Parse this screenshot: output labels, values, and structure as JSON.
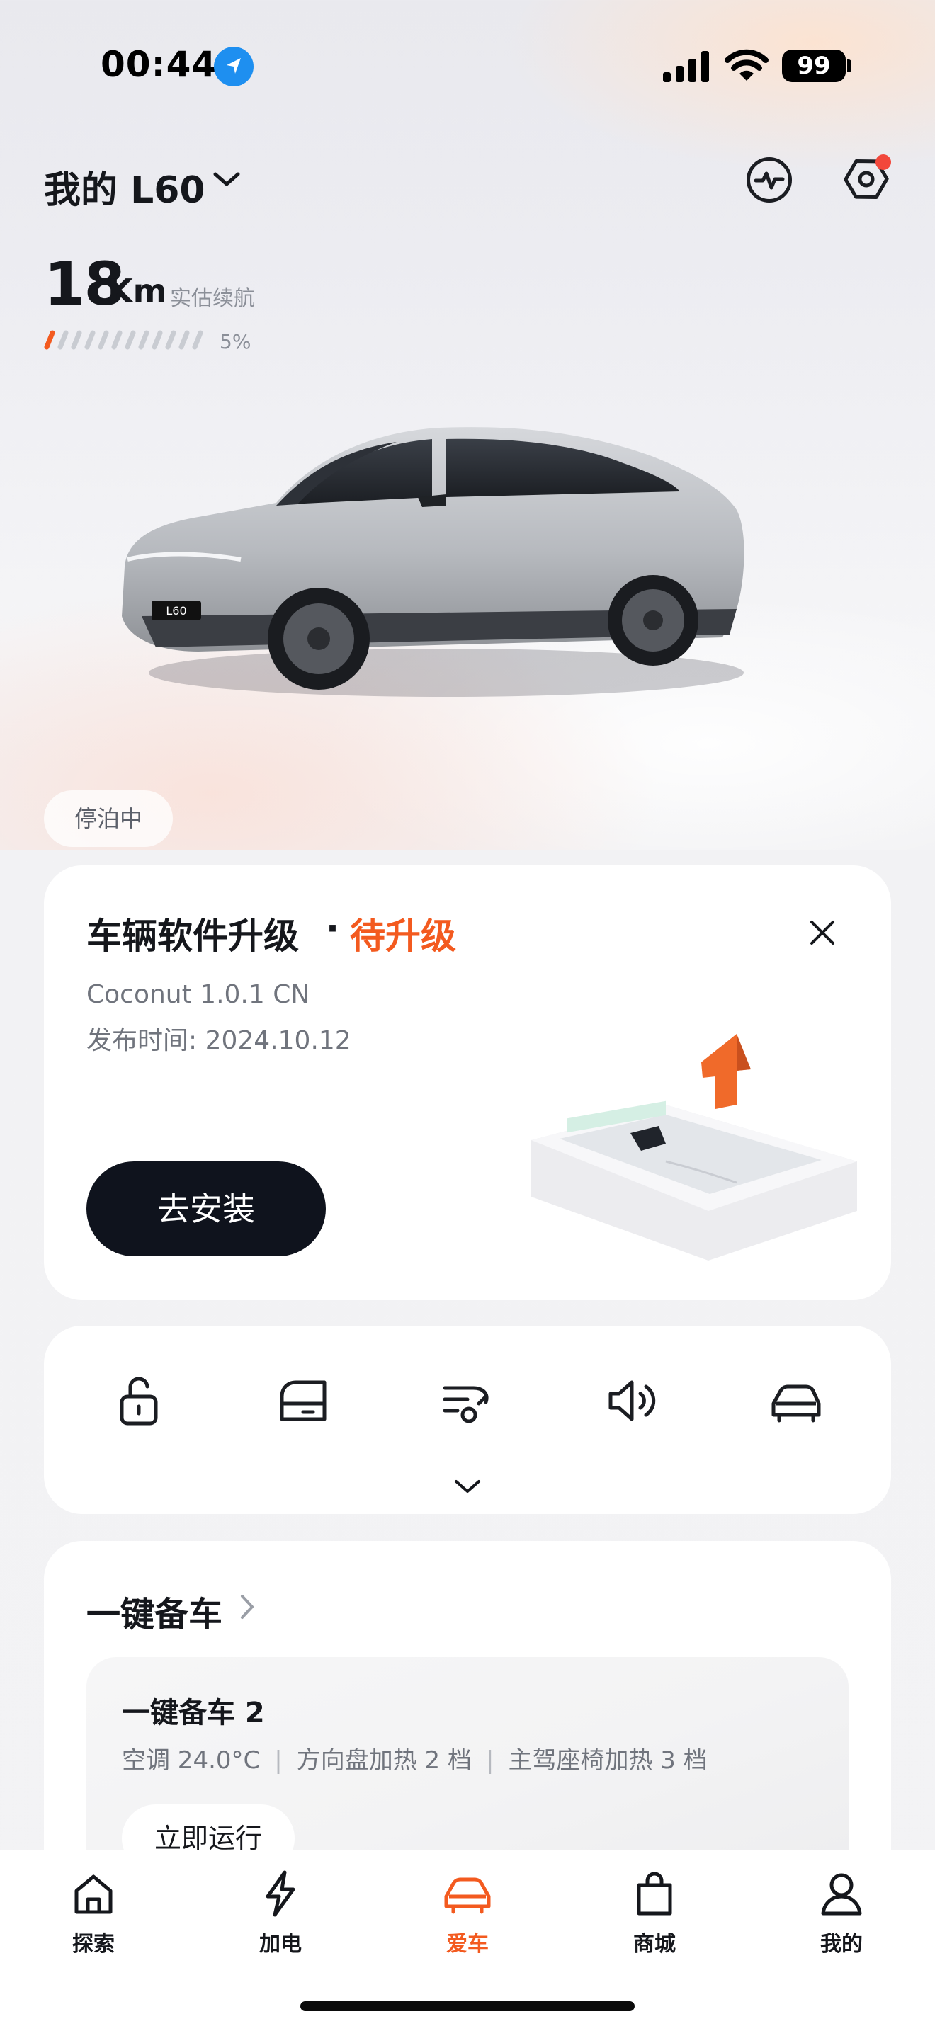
{
  "status_bar": {
    "time": "00:44",
    "battery_level": "99"
  },
  "header": {
    "car_title": "我的 L60"
  },
  "range": {
    "value": "18",
    "unit": "Km",
    "label": "实估续航",
    "battery_percent": "5%",
    "battery_fraction": 0.05
  },
  "car": {
    "plate_text": "L60"
  },
  "parking_status": "停泊中",
  "software_update": {
    "title": "车辆软件升级",
    "separator": "·",
    "status": "待升级",
    "version": "Coconut 1.0.1 CN",
    "release_date": "发布时间: 2024.10.12",
    "install_label": "去安装"
  },
  "quick_controls": {
    "icons": [
      "unlock-icon",
      "trunk-icon",
      "ventilation-icon",
      "horn-icon",
      "car-lights-icon"
    ]
  },
  "one_key_ready": {
    "title": "一键备车",
    "preset_name": "一键备车 2",
    "details": [
      "空调 24.0°C",
      "方向盘加热 2 档",
      "主驾座椅加热 3 档"
    ],
    "run_label": "立即运行"
  },
  "tab_bar": {
    "items": [
      {
        "label": "探索",
        "icon": "home-icon"
      },
      {
        "label": "加电",
        "icon": "lightning-icon"
      },
      {
        "label": "爱车",
        "icon": "car-icon"
      },
      {
        "label": "商城",
        "icon": "shopping-bag-icon"
      },
      {
        "label": "我的",
        "icon": "person-icon"
      }
    ],
    "active_index": 2
  },
  "colors": {
    "accent": "#f35a1f",
    "dark_button": "#0f131d",
    "notify_dot": "#f2473b"
  }
}
